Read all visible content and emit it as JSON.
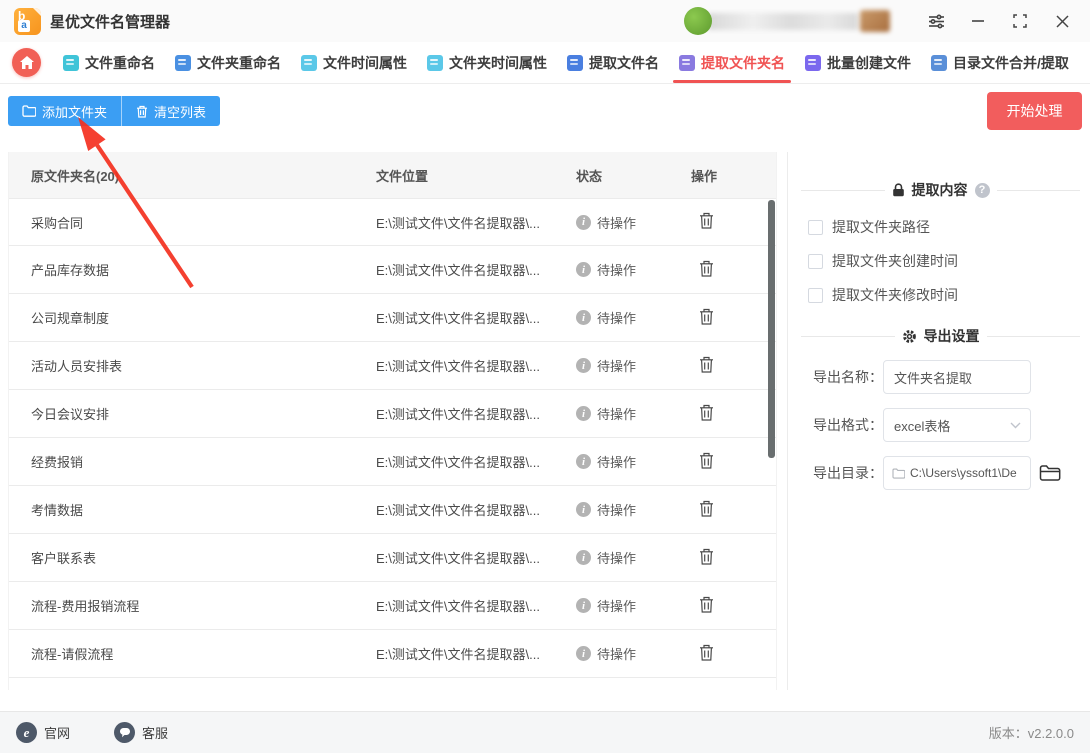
{
  "titlebar": {
    "app_title": "星优文件名管理器",
    "controls": [
      "sliders-icon",
      "minimize-icon",
      "maximize-icon",
      "close-icon"
    ]
  },
  "tabs": [
    {
      "id": "file-rename",
      "label": "文件重命名",
      "active": false,
      "icon": "documents-icon",
      "icon_color": "#40c4d8"
    },
    {
      "id": "folder-rename",
      "label": "文件夹重命名",
      "active": false,
      "icon": "folder-icon",
      "icon_color": "#4a90e2"
    },
    {
      "id": "file-time",
      "label": "文件时间属性",
      "active": false,
      "icon": "clock-icon",
      "icon_color": "#5bc8e8"
    },
    {
      "id": "folder-time",
      "label": "文件夹时间属性",
      "active": false,
      "icon": "clock-icon",
      "icon_color": "#5bc8e8"
    },
    {
      "id": "extract-filename",
      "label": "提取文件名",
      "active": false,
      "icon": "document-icon",
      "icon_color": "#4a7fe0"
    },
    {
      "id": "extract-foldername",
      "label": "提取文件夹名",
      "active": true,
      "icon": "book-icon",
      "icon_color": "#8a7ae0"
    },
    {
      "id": "batch-create",
      "label": "批量创建文件",
      "active": false,
      "icon": "binder-icon",
      "icon_color": "#7b68ee"
    },
    {
      "id": "merge-extract",
      "label": "目录文件合并/提取",
      "active": false,
      "icon": "folder-doc-icon",
      "icon_color": "#5a8fd8"
    }
  ],
  "toolbar": {
    "add_folder_label": "添加文件夹",
    "clear_list_label": "清空列表",
    "start_label": "开始处理"
  },
  "table": {
    "headers": [
      "原文件夹名(20)",
      "文件位置",
      "状态",
      "操作"
    ],
    "rows": [
      {
        "name": "采购合同",
        "path": "E:\\测试文件\\文件名提取器\\...",
        "status": "待操作"
      },
      {
        "name": "产品库存数据",
        "path": "E:\\测试文件\\文件名提取器\\...",
        "status": "待操作"
      },
      {
        "name": "公司规章制度",
        "path": "E:\\测试文件\\文件名提取器\\...",
        "status": "待操作"
      },
      {
        "name": "活动人员安排表",
        "path": "E:\\测试文件\\文件名提取器\\...",
        "status": "待操作"
      },
      {
        "name": "今日会议安排",
        "path": "E:\\测试文件\\文件名提取器\\...",
        "status": "待操作"
      },
      {
        "name": "经费报销",
        "path": "E:\\测试文件\\文件名提取器\\...",
        "status": "待操作"
      },
      {
        "name": "考情数据",
        "path": "E:\\测试文件\\文件名提取器\\...",
        "status": "待操作"
      },
      {
        "name": "客户联系表",
        "path": "E:\\测试文件\\文件名提取器\\...",
        "status": "待操作"
      },
      {
        "name": "流程-费用报销流程",
        "path": "E:\\测试文件\\文件名提取器\\...",
        "status": "待操作"
      },
      {
        "name": "流程-请假流程",
        "path": "E:\\测试文件\\文件名提取器\\...",
        "status": "待操作"
      },
      {
        "name": "",
        "path": "",
        "status": ""
      }
    ]
  },
  "sidebar": {
    "extract_section_title": "提取内容",
    "checkboxes": [
      "提取文件夹路径",
      "提取文件夹创建时间",
      "提取文件夹修改时间"
    ],
    "export_section_title": "导出设置",
    "export_name_label": "导出名称：",
    "export_name_value": "文件夹名提取",
    "export_format_label": "导出格式：",
    "export_format_value": "excel表格",
    "export_dir_label": "导出目录：",
    "export_dir_value": "C:\\Users\\yssoft1\\De"
  },
  "footer": {
    "website_label": "官网",
    "support_label": "客服",
    "version": "版本：v2.2.0.0"
  },
  "colors": {
    "accent_blue": "#3b9ef3",
    "accent_red": "#f25d5d",
    "active_tab_red": "#f05353",
    "home_button_red": "#f16056",
    "arrow_red": "#f4301f",
    "avatar_green": "#6fae3c",
    "app_icon_orange": "#f7941e"
  }
}
